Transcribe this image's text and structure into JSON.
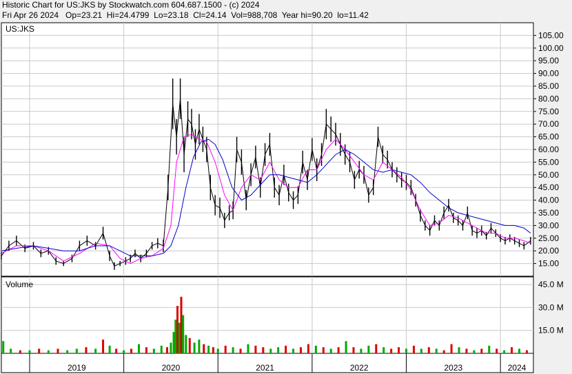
{
  "header": {
    "line1": "Historic Chart for US:JKS by Stockwatch.com 604.687.1500 - (c) 2024",
    "line2": "Fri Apr 26 2024   Op=23.21  Hi=24.4799  Lo=23.18  Cl=24.14  Vol=988,708  Year hi=90.20  lo=11.42"
  },
  "colors": {
    "background": "#f0f0f0",
    "panel": "#ffffff",
    "grid": "#c8c8c8",
    "price": "#000000",
    "ma_short": "#ff00ff",
    "ma_long": "#0000cc",
    "volume_up": "#00aa00",
    "volume_down": "#dd0000"
  },
  "chart_data": [
    {
      "type": "line",
      "panel": "price",
      "label": "US:JKS",
      "ylim": [
        10,
        110
      ],
      "y_ticks": [
        "105.00",
        "100.00",
        "95.00",
        "90.00",
        "85.00",
        "80.00",
        "75.00",
        "70.00",
        "65.00",
        "60.00",
        "55.00",
        "50.00",
        "45.00",
        "40.00",
        "35.00",
        "30.00",
        "25.00",
        "20.00",
        "15.00"
      ],
      "y_tick_values": [
        105,
        100,
        95,
        90,
        85,
        80,
        75,
        70,
        65,
        60,
        55,
        50,
        45,
        40,
        35,
        30,
        25,
        20,
        15
      ],
      "x_tick_labels": [
        "2019",
        "2020",
        "2021",
        "2022",
        "2023",
        "2024"
      ],
      "x_tick_values": [
        2019.0,
        2020.0,
        2021.0,
        2022.0,
        2023.0,
        2024.0
      ],
      "xlim": [
        2018.7,
        2024.35
      ],
      "grid": true,
      "series": [
        {
          "role": "price",
          "x": [
            2018.7,
            2018.78,
            2018.86,
            2018.95,
            2019.04,
            2019.12,
            2019.2,
            2019.28,
            2019.36,
            2019.45,
            2019.53,
            2019.61,
            2019.7,
            2019.78,
            2019.85,
            2019.9,
            2019.96,
            2020.02,
            2020.07,
            2020.12,
            2020.18,
            2020.24,
            2020.3,
            2020.36,
            2020.42,
            2020.47,
            2020.52,
            2020.56,
            2020.6,
            2020.64,
            2020.68,
            2020.72,
            2020.76,
            2020.8,
            2020.84,
            2020.88,
            2020.92,
            2020.97,
            2021.02,
            2021.07,
            2021.12,
            2021.16,
            2021.2,
            2021.25,
            2021.3,
            2021.35,
            2021.4,
            2021.45,
            2021.5,
            2021.55,
            2021.6,
            2021.65,
            2021.7,
            2021.75,
            2021.8,
            2021.85,
            2021.9,
            2021.95,
            2022.0,
            2022.05,
            2022.1,
            2022.15,
            2022.2,
            2022.25,
            2022.3,
            2022.35,
            2022.4,
            2022.45,
            2022.5,
            2022.55,
            2022.6,
            2022.65,
            2022.7,
            2022.75,
            2022.8,
            2022.85,
            2022.9,
            2022.95,
            2023.0,
            2023.05,
            2023.1,
            2023.15,
            2023.2,
            2023.25,
            2023.3,
            2023.35,
            2023.4,
            2023.45,
            2023.5,
            2023.55,
            2023.6,
            2023.65,
            2023.7,
            2023.75,
            2023.8,
            2023.85,
            2023.9,
            2023.95,
            2024.0,
            2024.05,
            2024.1,
            2024.15,
            2024.2,
            2024.25,
            2024.32
          ],
          "y": [
            18,
            22,
            24,
            21,
            22,
            19,
            20,
            16,
            15,
            17,
            22,
            24,
            22,
            27,
            18,
            14,
            15,
            16,
            17,
            19,
            17,
            19,
            22,
            23,
            22,
            45,
            78,
            65,
            80,
            58,
            72,
            70,
            62,
            68,
            64,
            60,
            45,
            38,
            37,
            32,
            35,
            36,
            60,
            55,
            40,
            50,
            57,
            45,
            58,
            62,
            45,
            42,
            50,
            43,
            40,
            42,
            55,
            48,
            60,
            52,
            58,
            70,
            68,
            66,
            62,
            58,
            55,
            48,
            52,
            50,
            42,
            45,
            65,
            58,
            56,
            52,
            50,
            48,
            47,
            45,
            40,
            34,
            30,
            28,
            32,
            30,
            35,
            38,
            33,
            32,
            30,
            35,
            28,
            27,
            28,
            26,
            29,
            27,
            25,
            24,
            25,
            24,
            23,
            22,
            24
          ],
          "range": [
            3,
            4,
            4,
            3,
            3,
            3,
            3,
            3,
            2,
            3,
            4,
            4,
            3,
            5,
            4,
            3,
            2,
            3,
            3,
            3,
            3,
            3,
            3,
            4,
            5,
            10,
            20,
            14,
            16,
            14,
            14,
            12,
            12,
            12,
            10,
            10,
            10,
            8,
            8,
            6,
            6,
            7,
            10,
            10,
            8,
            9,
            9,
            8,
            9,
            9,
            8,
            8,
            8,
            7,
            7,
            7,
            9,
            8,
            9,
            9,
            9,
            12,
            10,
            9,
            9,
            8,
            8,
            7,
            7,
            7,
            6,
            6,
            8,
            7,
            7,
            6,
            6,
            6,
            6,
            6,
            5,
            5,
            4,
            4,
            4,
            4,
            5,
            5,
            4,
            4,
            4,
            5,
            4,
            4,
            4,
            3,
            4,
            3,
            3,
            3,
            3,
            3,
            3,
            3,
            3
          ]
        },
        {
          "role": "ma_short",
          "x": [
            2018.7,
            2018.86,
            2019.04,
            2019.2,
            2019.36,
            2019.53,
            2019.7,
            2019.85,
            2019.96,
            2020.07,
            2020.18,
            2020.3,
            2020.42,
            2020.5,
            2020.56,
            2020.64,
            2020.72,
            2020.8,
            2020.88,
            2020.97,
            2021.07,
            2021.16,
            2021.25,
            2021.35,
            2021.45,
            2021.55,
            2021.65,
            2021.75,
            2021.85,
            2021.95,
            2022.05,
            2022.15,
            2022.25,
            2022.35,
            2022.45,
            2022.55,
            2022.65,
            2022.75,
            2022.85,
            2022.95,
            2023.05,
            2023.15,
            2023.25,
            2023.35,
            2023.45,
            2023.55,
            2023.65,
            2023.75,
            2023.85,
            2023.95,
            2024.05,
            2024.15,
            2024.25,
            2024.32
          ],
          "y": [
            19,
            22,
            22,
            20,
            16,
            19,
            23,
            22,
            17,
            15,
            17,
            18,
            21,
            30,
            55,
            65,
            66,
            64,
            63,
            55,
            42,
            36,
            45,
            50,
            48,
            55,
            48,
            45,
            45,
            52,
            52,
            60,
            64,
            60,
            55,
            50,
            48,
            55,
            52,
            49,
            44,
            36,
            30,
            31,
            34,
            33,
            31,
            29,
            27,
            27,
            25,
            25,
            24,
            23
          ]
        },
        {
          "role": "ma_long",
          "x": [
            2018.7,
            2018.86,
            2019.04,
            2019.2,
            2019.36,
            2019.53,
            2019.7,
            2019.85,
            2019.96,
            2020.07,
            2020.18,
            2020.3,
            2020.42,
            2020.5,
            2020.58,
            2020.66,
            2020.74,
            2020.82,
            2020.9,
            2020.97,
            2021.05,
            2021.15,
            2021.25,
            2021.35,
            2021.45,
            2021.55,
            2021.65,
            2021.75,
            2021.85,
            2021.95,
            2022.05,
            2022.15,
            2022.25,
            2022.35,
            2022.45,
            2022.55,
            2022.65,
            2022.75,
            2022.85,
            2022.95,
            2023.05,
            2023.15,
            2023.25,
            2023.35,
            2023.45,
            2023.55,
            2023.65,
            2023.75,
            2023.85,
            2023.95,
            2024.05,
            2024.15,
            2024.25,
            2024.32
          ],
          "y": [
            20,
            21,
            22,
            21,
            20,
            20,
            22,
            22,
            20,
            18,
            18,
            18,
            19,
            22,
            30,
            45,
            57,
            63,
            64,
            62,
            56,
            45,
            40,
            42,
            46,
            50,
            50,
            49,
            48,
            47,
            50,
            54,
            58,
            60,
            58,
            55,
            52,
            51,
            52,
            51,
            50,
            47,
            43,
            40,
            37,
            35,
            34,
            33,
            32,
            31,
            30,
            30,
            29,
            27
          ]
        }
      ]
    },
    {
      "type": "bar",
      "panel": "volume",
      "label": "Volume",
      "ylim": [
        0,
        50
      ],
      "y_ticks": [
        "45.0 M",
        "30.0 M",
        "15.0 M"
      ],
      "y_tick_values": [
        45,
        30,
        15
      ],
      "x_tick_labels": [
        "2019",
        "2020",
        "2021",
        "2022",
        "2023",
        "2024"
      ],
      "xlim": [
        2018.7,
        2024.35
      ],
      "series": [
        {
          "name": "volume_millions",
          "x": [
            2018.72,
            2018.8,
            2018.9,
            2019.0,
            2019.1,
            2019.2,
            2019.3,
            2019.4,
            2019.5,
            2019.6,
            2019.7,
            2019.78,
            2019.85,
            2019.92,
            2020.0,
            2020.08,
            2020.16,
            2020.24,
            2020.32,
            2020.4,
            2020.46,
            2020.5,
            2020.53,
            2020.55,
            2020.57,
            2020.59,
            2020.61,
            2020.63,
            2020.66,
            2020.7,
            2020.75,
            2020.8,
            2020.85,
            2020.9,
            2020.95,
            2021.0,
            2021.08,
            2021.16,
            2021.24,
            2021.32,
            2021.4,
            2021.48,
            2021.56,
            2021.64,
            2021.72,
            2021.8,
            2021.88,
            2021.96,
            2022.04,
            2022.12,
            2022.2,
            2022.28,
            2022.36,
            2022.44,
            2022.52,
            2022.6,
            2022.68,
            2022.76,
            2022.84,
            2022.92,
            2023.0,
            2023.08,
            2023.16,
            2023.24,
            2023.32,
            2023.4,
            2023.48,
            2023.56,
            2023.64,
            2023.72,
            2023.8,
            2023.88,
            2023.96,
            2024.04,
            2024.12,
            2024.2,
            2024.28
          ],
          "values": [
            8,
            3,
            2,
            2,
            3,
            2,
            3,
            2,
            3,
            4,
            3,
            9,
            5,
            3,
            2,
            3,
            6,
            4,
            3,
            5,
            4,
            7,
            14,
            22,
            31,
            20,
            37,
            25,
            12,
            10,
            7,
            9,
            6,
            5,
            4,
            3,
            5,
            4,
            3,
            6,
            5,
            4,
            3,
            4,
            5,
            3,
            4,
            6,
            5,
            4,
            3,
            4,
            8,
            4,
            3,
            5,
            6,
            4,
            3,
            4,
            3,
            5,
            3,
            4,
            3,
            2,
            6,
            4,
            3,
            2,
            3,
            5,
            3,
            2,
            4,
            3,
            2
          ],
          "up": [
            1,
            1,
            0,
            1,
            0,
            1,
            0,
            1,
            1,
            0,
            1,
            0,
            1,
            0,
            1,
            0,
            1,
            0,
            1,
            1,
            0,
            1,
            1,
            1,
            0,
            1,
            0,
            1,
            1,
            0,
            1,
            1,
            0,
            1,
            0,
            1,
            0,
            1,
            0,
            1,
            0,
            0,
            1,
            1,
            0,
            1,
            0,
            0,
            1,
            0,
            1,
            0,
            1,
            0,
            1,
            1,
            0,
            1,
            0,
            0,
            1,
            0,
            1,
            0,
            1,
            0,
            0,
            1,
            0,
            1,
            0,
            1,
            0,
            1,
            0,
            1,
            0
          ]
        }
      ]
    }
  ]
}
